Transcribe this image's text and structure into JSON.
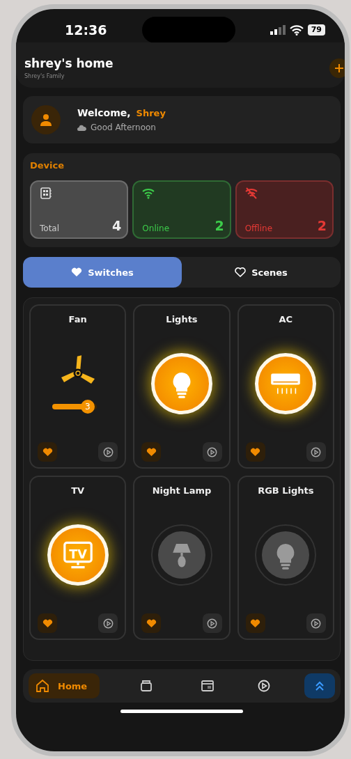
{
  "status_bar": {
    "time": "12:36",
    "battery": "79"
  },
  "header": {
    "title": "shrey's home",
    "subtitle": "Shrey's Family"
  },
  "welcome": {
    "greeting": "Welcome,",
    "name": "Shrey",
    "weather": "Good Afternoon"
  },
  "device_summary": {
    "title": "Device",
    "stats": [
      {
        "kind": "total",
        "label": "Total",
        "count": "4"
      },
      {
        "kind": "online",
        "label": "Online",
        "count": "2"
      },
      {
        "kind": "offline",
        "label": "Offline",
        "count": "2"
      }
    ]
  },
  "tabs": [
    {
      "label": "Switches",
      "selected": true
    },
    {
      "label": "Scenes",
      "selected": false
    }
  ],
  "devices": [
    {
      "name": "Fan",
      "kind": "fan",
      "on": true,
      "favorite": true,
      "level": 0.8,
      "reading": "3"
    },
    {
      "name": "Lights",
      "kind": "bulb",
      "on": true,
      "favorite": true
    },
    {
      "name": "AC",
      "kind": "ac",
      "on": true,
      "favorite": true
    },
    {
      "name": "TV",
      "kind": "tv",
      "on": true,
      "favorite": true,
      "icon_label": "TV"
    },
    {
      "name": "Night Lamp",
      "kind": "lamp",
      "on": false,
      "favorite": true
    },
    {
      "name": "RGB Lights",
      "kind": "bulb",
      "on": false,
      "favorite": true
    }
  ],
  "nav": [
    {
      "kind": "home",
      "label": "Home",
      "selected": true
    },
    {
      "kind": "box",
      "selected": false
    },
    {
      "kind": "calendar",
      "selected": false
    },
    {
      "kind": "play",
      "selected": false
    },
    {
      "kind": "up",
      "selected": false
    }
  ]
}
